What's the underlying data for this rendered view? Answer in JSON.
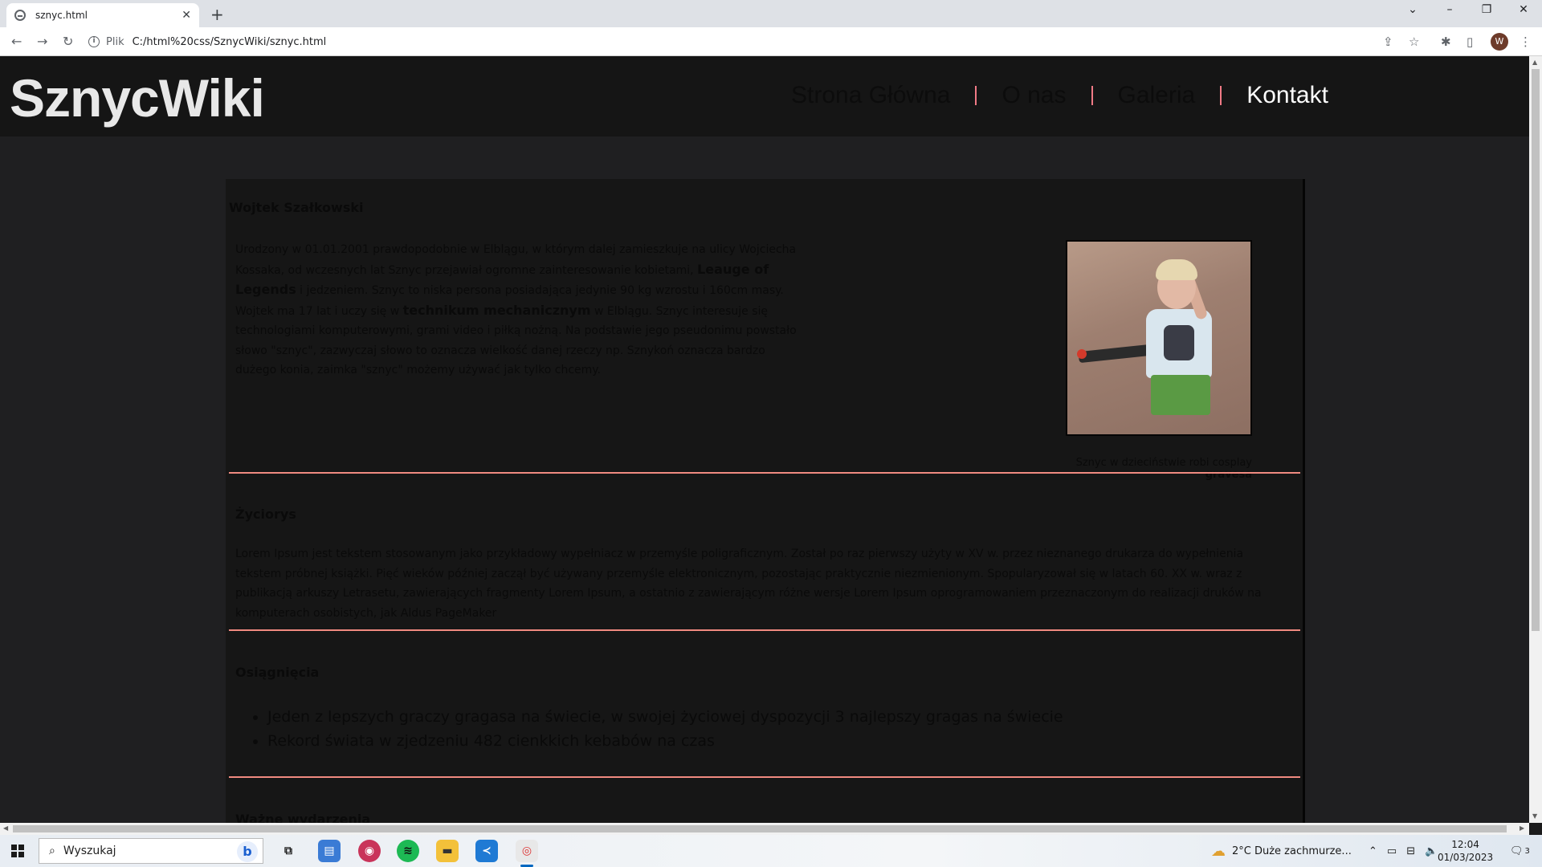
{
  "browser": {
    "tab_title": "sznyc.html",
    "tab_close": "✕",
    "new_tab": "+",
    "address_prefix": "Plik",
    "url": "C:/html%20css/SznycWiki/sznyc.html",
    "avatar_letter": "W"
  },
  "site": {
    "logo": "SznycWiki",
    "nav": [
      "Strona Główna",
      "O nas",
      "Galeria",
      "Kontakt"
    ],
    "active_nav": "Kontakt"
  },
  "profile": {
    "name": "Wojtek Szałkowski",
    "bio_1": "Urodzony w 01.01.2001 prawdopodobnie w Elblągu, w którym dalej zamieszkuje na ulicy Wojciecha Kossaka, od wczesnych lat Sznyc przejawiał ogromne zainteresowanie kobietami, ",
    "bio_bold_1": "Leauge of Legends",
    "bio_2": " i jedzeniem. Sznyc to niska persona posiadająca jedynie 90 kg wzrostu i 160cm masy. Wojtek ma 17 lat i uczy się w ",
    "bio_bold_2": "technikum mechanicznym",
    "bio_3": " w Elblągu. Sznyc interesuje się technologiami komputerowymi, grami video i piłką nożną. Na podstawie jego pseudonimu powstało słowo \"sznyc\", zazwyczaj słowo to oznacza wielkość danej rzeczy np. Sznykoń oznacza bardzo dużego konia, zaimka \"sznyc\" możemy używać jak tylko chcemy.",
    "photo_caption": "Sznyc w dzieciństwie robi cosplay ",
    "photo_caption_bold": "gravesa"
  },
  "sections": {
    "zyciorys_title": "Życiorys",
    "zyciorys_text": "Lorem Ipsum jest tekstem stosowanym jako przykładowy wypełniacz w przemyśle poligraficznym. Został po raz pierwszy użyty w XV w. przez nieznanego drukarza do wypełnienia tekstem próbnej książki. Pięć wieków później zaczął być używany przemyśle elektronicznym, pozostając praktycznie niezmienionym. Spopularyzował się w latach 60. XX w. wraz z publikacją arkuszy Letrasetu, zawierających fragmenty Lorem Ipsum, a ostatnio z zawierającym różne wersje Lorem Ipsum oprogramowaniem przeznaczonym do realizacji druków na komputerach osobistych, jak Aldus PageMaker",
    "osiagniecia_title": "Osiągnięcia",
    "osiagniecia": [
      "Jeden z lepszych graczy gragasa na świecie, w swojej życiowej dyspozycji 3 najlepszy gragas na świecie",
      "Rekord świata w zjedzeniu 482 cienkkich kebabów na czas"
    ],
    "next_title_partial": "Ważne wydarzenia"
  },
  "taskbar": {
    "search_placeholder": "Wyszukaj",
    "weather": "2°C  Duże zachmurze...",
    "time": "12:04",
    "date": "01/03/2023",
    "notifications": "3"
  }
}
